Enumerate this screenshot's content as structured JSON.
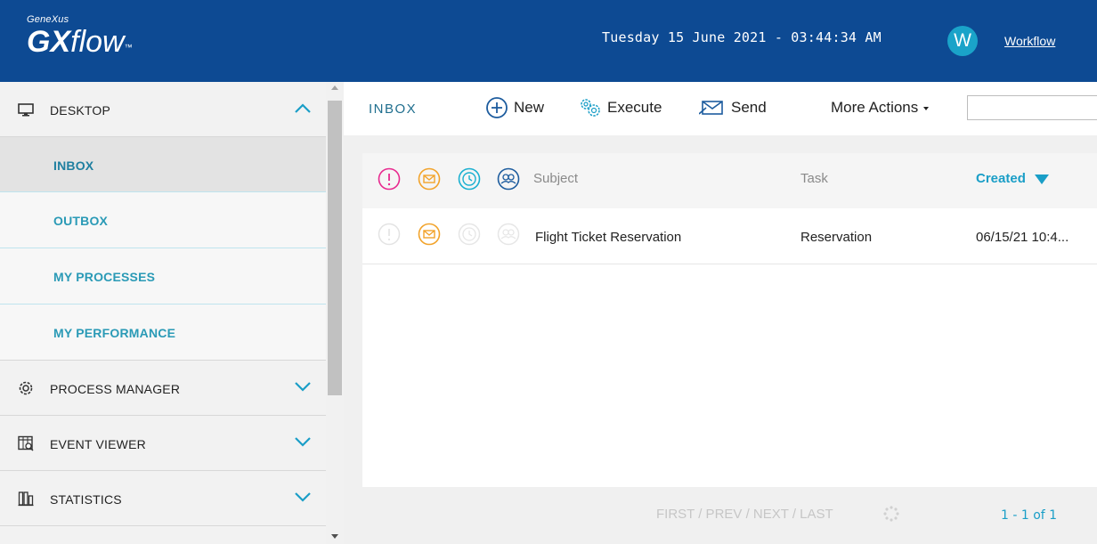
{
  "header": {
    "brand": "GeneXus",
    "product_bold": "GX",
    "product_light": "flow",
    "trademark": "™",
    "datetime": "Tuesday 15 June 2021 - 03:44:34 AM",
    "avatar_initial": "W",
    "user_link": "Workflow",
    "background": "#0d4a93",
    "avatar_color": "#1aa3c9"
  },
  "sidebar": {
    "sections": [
      {
        "label": "DESKTOP",
        "icon": "desktop-icon",
        "expanded": true
      },
      {
        "label": "PROCESS MANAGER",
        "icon": "gear-icon",
        "expanded": false
      },
      {
        "label": "EVENT VIEWER",
        "icon": "event-viewer-icon",
        "expanded": false
      },
      {
        "label": "STATISTICS",
        "icon": "statistics-icon",
        "expanded": false
      }
    ],
    "desktop_items": [
      {
        "label": "INBOX",
        "active": true
      },
      {
        "label": "OUTBOX",
        "active": false
      },
      {
        "label": "MY PROCESSES",
        "active": false
      },
      {
        "label": "MY PERFORMANCE",
        "active": false
      }
    ],
    "accent": "#2a9ab6"
  },
  "toolbar": {
    "title": "INBOX",
    "new_label": "New",
    "execute_label": "Execute",
    "send_label": "Send",
    "more_actions_label": "More Actions",
    "search_value": ""
  },
  "grid": {
    "header_icons": [
      "priority-icon",
      "message-icon",
      "deadline-icon",
      "participants-icon"
    ],
    "columns": {
      "subject": "Subject",
      "task": "Task",
      "created": "Created"
    },
    "sort": "descending",
    "rows": [
      {
        "subject": "Flight Ticket Reservation",
        "task": "Reservation",
        "created": "06/15/21 10:4..."
      }
    ],
    "icon_colors": {
      "priority": "#e8298f",
      "message": "#f2a32a",
      "deadline": "#1ab0d0",
      "participants": "#1d5c9e",
      "created": "#1a9ec7"
    }
  },
  "pager": {
    "links": "FIRST / PREV / NEXT / LAST",
    "count": "1 - 1 of 1"
  }
}
